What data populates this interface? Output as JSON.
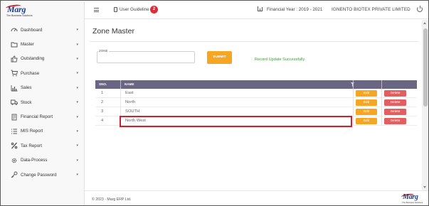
{
  "brand": {
    "logo_text": "Marg",
    "tagline": "The Business Solutions",
    "accent": "#d82e3a"
  },
  "topbar": {
    "user_guideline_label": "User Guideline",
    "user_guideline_badge": "2",
    "financial_year_label": "Financial Year : 2019 - 2021",
    "company_name": "IGNENTO BIOTEX PRIVATE LIMITED"
  },
  "sidebar": {
    "items": [
      {
        "label": "Dashboard",
        "icon": "dashboard-icon"
      },
      {
        "label": "Master",
        "icon": "folder-icon"
      },
      {
        "label": "Outstanding",
        "icon": "thumbs-up-icon"
      },
      {
        "label": "Purchase",
        "icon": "cart-icon"
      },
      {
        "label": "Sales",
        "icon": "bar-chart-icon"
      },
      {
        "label": "Stock",
        "icon": "truck-icon"
      },
      {
        "label": "Financial Report",
        "icon": "report-icon"
      },
      {
        "label": "MIS Report",
        "icon": "list-icon"
      },
      {
        "label": "Tax Report",
        "icon": "percent-icon"
      },
      {
        "label": "Data-Process",
        "icon": "gear-icon"
      },
      {
        "label": "Change Password",
        "icon": "key-icon"
      }
    ]
  },
  "main": {
    "page_title": "Zone Master",
    "form": {
      "zone_label": "ZONE",
      "zone_value": "",
      "submit_label": "SUBMIT",
      "status_message": "Record Update Successfully"
    },
    "table": {
      "headers": [
        "SNO.",
        "NAME"
      ],
      "edit_label": "Edit",
      "delete_label": "Delete",
      "rows": [
        {
          "sno": "1",
          "name": "East"
        },
        {
          "sno": "2",
          "name": "North"
        },
        {
          "sno": "3",
          "name": "SOUTH"
        },
        {
          "sno": "4",
          "name": "North West"
        }
      ]
    }
  },
  "footer": {
    "copyright": "© 2023 - Marg ERP Ltd."
  },
  "colors": {
    "table_header": "#696684",
    "edit_button": "#f5a623",
    "delete_button": "#e35e60",
    "submit_button": "#f5a623",
    "success_text": "#3f9a3f",
    "highlight_border": "#d0202e"
  }
}
